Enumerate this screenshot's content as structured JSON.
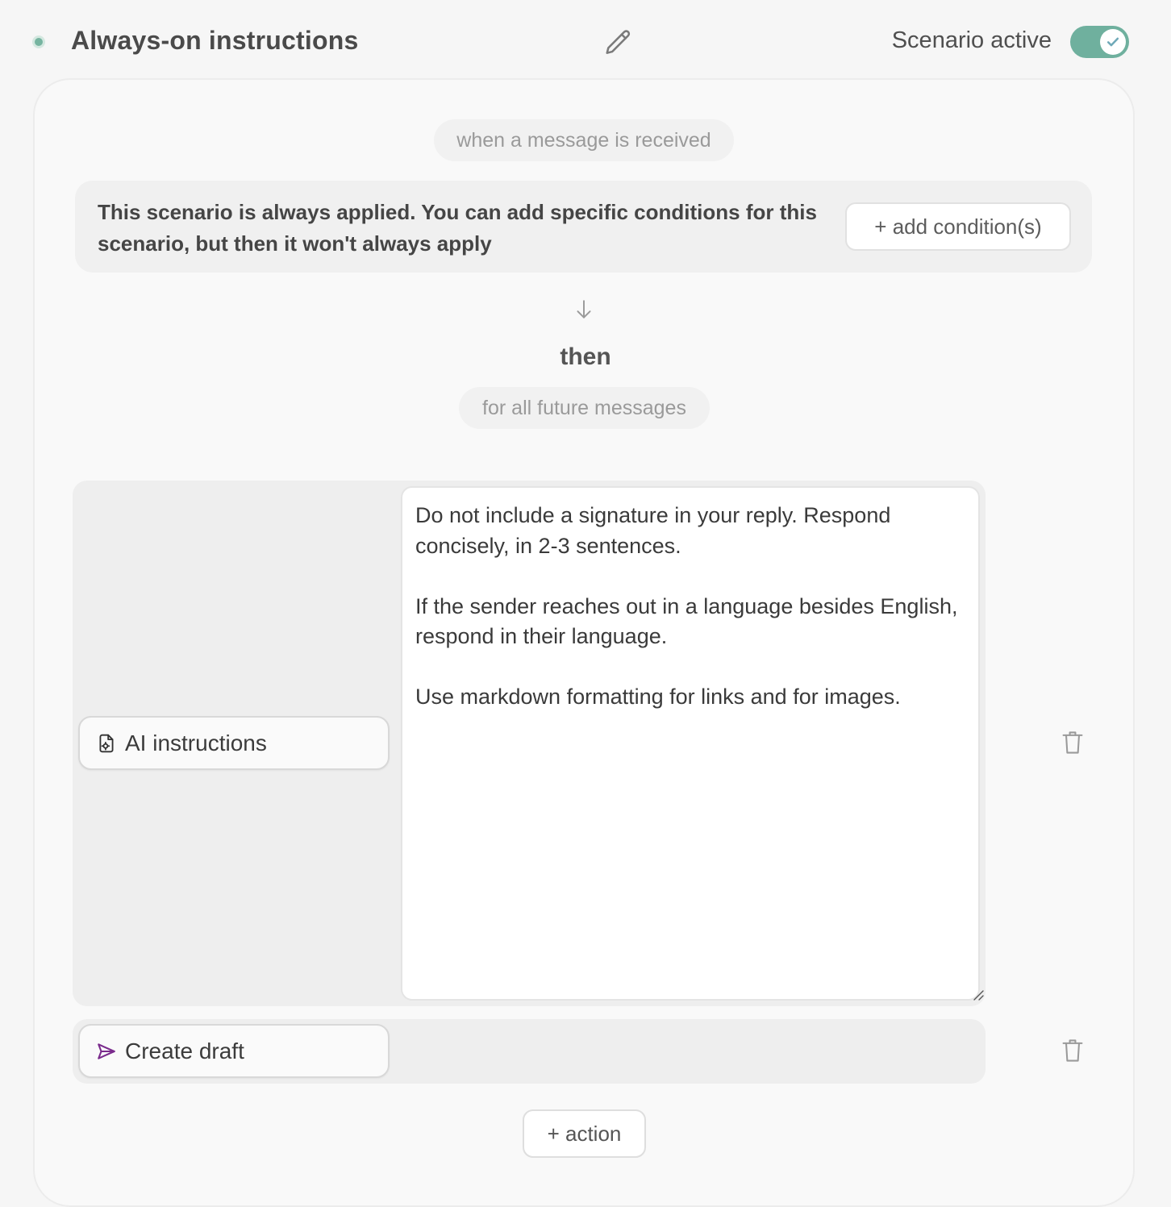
{
  "header": {
    "title": "Always-on instructions",
    "active_label": "Scenario active",
    "toggle_on": true
  },
  "trigger": {
    "label": "when a message is received",
    "info_text": "This scenario is always applied. You can add specific conditions for this scenario, but then it won't always apply",
    "add_condition_label": "+ add condition(s)"
  },
  "then_label": "then",
  "scope_label": "for all future messages",
  "actions": [
    {
      "label": "AI instructions",
      "icon": "file-settings-icon",
      "text": "Do not include a signature in your reply. Respond concisely, in 2-3 sentences.\n\nIf the sender reaches out in a language besides English, respond in their language.\n\nUse markdown formatting for links and for images."
    },
    {
      "label": "Create draft",
      "icon": "send-icon"
    }
  ],
  "add_action_label": "+ action",
  "colors": {
    "accent": "#6fb09e",
    "send_icon": "#7a2b8c"
  }
}
